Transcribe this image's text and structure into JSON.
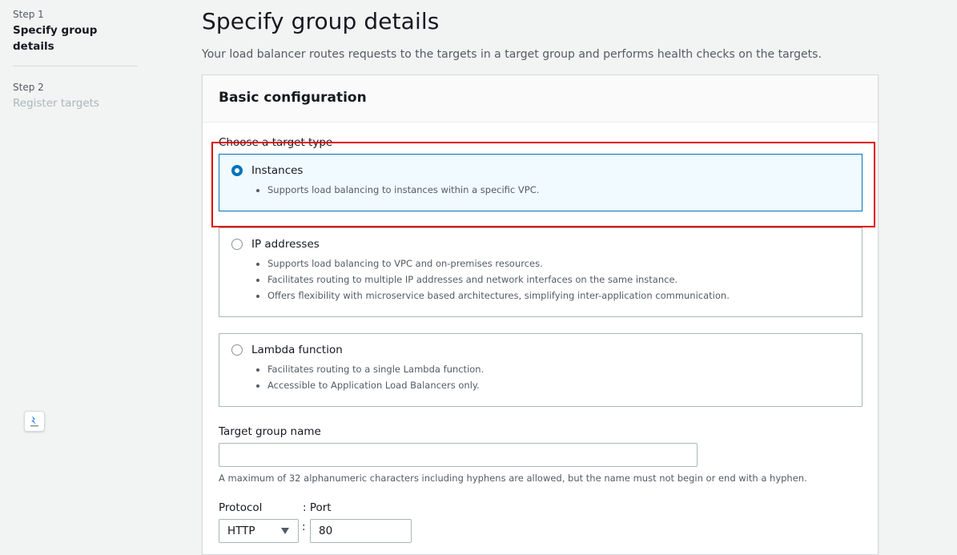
{
  "steps": [
    {
      "number": "Step 1",
      "title": "Specify group details",
      "state": "active"
    },
    {
      "number": "Step 2",
      "title": "Register targets",
      "state": "disabled"
    }
  ],
  "page": {
    "title": "Specify group details",
    "description": "Your load balancer routes requests to the targets in a target group and performs health checks on the targets."
  },
  "basic_config": {
    "title": "Basic configuration",
    "target_type_label": "Choose a target type",
    "target_types": [
      {
        "title": "Instances",
        "selected": true,
        "bullets": [
          "Supports load balancing to instances within a specific VPC."
        ]
      },
      {
        "title": "IP addresses",
        "selected": false,
        "bullets": [
          "Supports load balancing to VPC and on-premises resources.",
          "Facilitates routing to multiple IP addresses and network interfaces on the same instance.",
          "Offers flexibility with microservice based architectures, simplifying inter-application communication."
        ]
      },
      {
        "title": "Lambda function",
        "selected": false,
        "bullets": [
          "Facilitates routing to a single Lambda function.",
          "Accessible to Application Load Balancers only."
        ]
      }
    ],
    "target_group_name": {
      "label": "Target group name",
      "value": "",
      "hint": "A maximum of 32 alphanumeric characters including hyphens are allowed, but the name must not begin or end with a hyphen."
    },
    "protocol": {
      "label": "Protocol",
      "value": "HTTP",
      "separator": ":"
    },
    "port": {
      "label": ": Port",
      "value": "80"
    }
  },
  "colors": {
    "accent": "#0073bb",
    "highlight": "#e00000",
    "selected_bg": "#f1faff"
  },
  "icons": {
    "dropdown": "caret-down-icon",
    "widget": "assistant-widget-icon"
  }
}
